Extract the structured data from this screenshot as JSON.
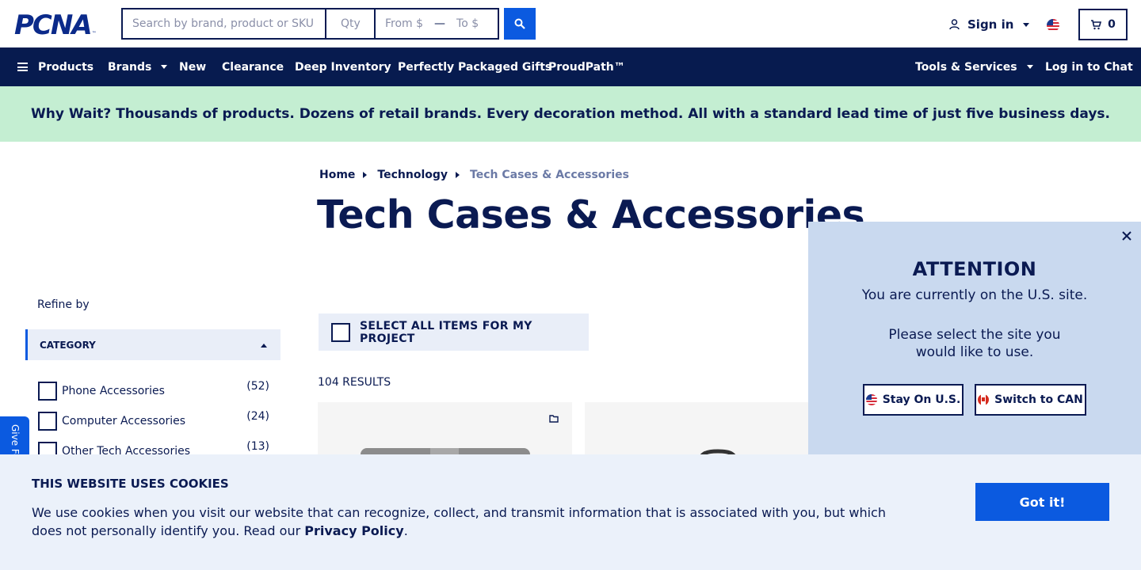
{
  "header": {
    "logo_text": "PCNA",
    "logo_tm": "™",
    "search_placeholder": "Search by brand, product or SKU",
    "qty_placeholder": "Qty",
    "price_from": "From $",
    "price_sep": "—",
    "price_to": "To $",
    "sign_in": "Sign in",
    "cart_count": "0"
  },
  "nav": {
    "products": "Products",
    "brands": "Brands",
    "new": "New",
    "clearance": "Clearance",
    "deep_inventory": "Deep Inventory",
    "gifts": "Perfectly Packaged Gifts",
    "proudpath": "ProudPath™",
    "tools": "Tools & Services",
    "chat": "Log in to Chat"
  },
  "promo": {
    "text": "Why Wait? Thousands of products. Dozens of retail brands. Every decoration method. All with a standard lead time of just five business days."
  },
  "breadcrumb": {
    "home": "Home",
    "technology": "Technology",
    "current": "Tech Cases & Accessories"
  },
  "page": {
    "title": "Tech Cases & Accessories",
    "select_all": "SELECT ALL ITEMS FOR MY PROJECT",
    "results": "104 RESULTS"
  },
  "sidebar": {
    "refine_by": "Refine by",
    "category_header": "CATEGORY",
    "items": [
      {
        "label": "Phone Accessories",
        "count": "(52)"
      },
      {
        "label": "Computer Accessories",
        "count": "(24)"
      },
      {
        "label": "Other Tech Accessories",
        "count": "(13)"
      }
    ],
    "feedback": "Give Feedback"
  },
  "attention": {
    "title": "ATTENTION",
    "line": "You are currently on the U.S. site.",
    "message": "Please select the site you would like to use.",
    "stay_us": "Stay On U.S.",
    "switch_can": "Switch to CAN"
  },
  "cookie": {
    "title": "THIS WEBSITE USES COOKIES",
    "text_before": "We use cookies when you visit our website that can recognize, collect, and transmit information that is associated with you, but which does not personally identify you. Read our ",
    "link": "Privacy Policy",
    "text_after": ".",
    "button": "Got it!"
  },
  "colors": {
    "navy": "#071b4f",
    "primary_blue": "#0b5ae0",
    "promo_green": "#c4eed2",
    "popup_bg": "#c9d9ef",
    "cookie_bg": "#ebf1fa"
  }
}
